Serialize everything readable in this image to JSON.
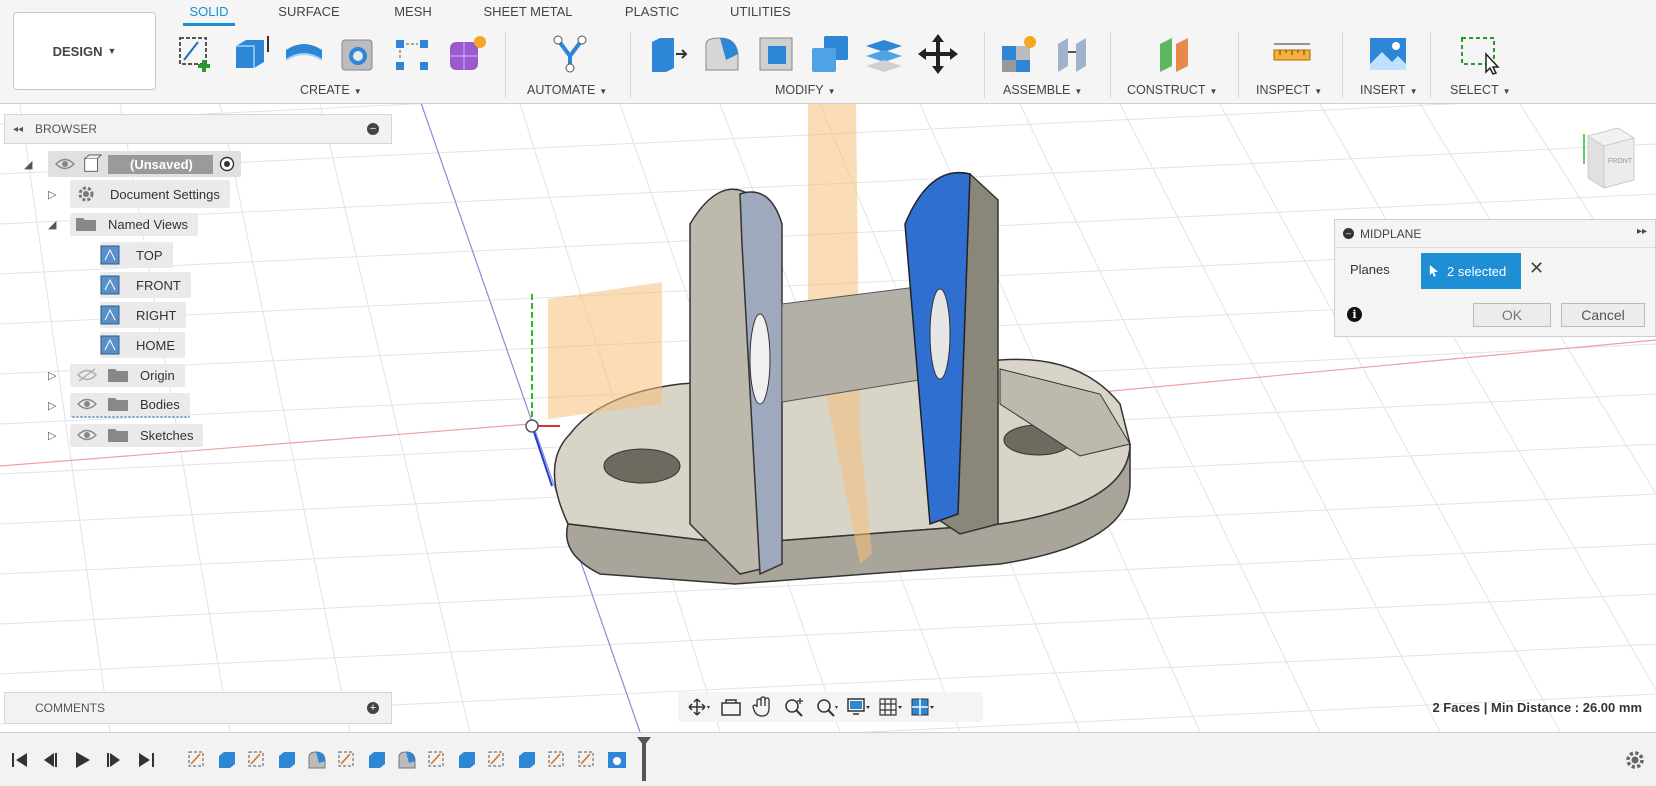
{
  "design_menu": {
    "label": "DESIGN"
  },
  "tabs": [
    {
      "label": "SOLID",
      "active": true
    },
    {
      "label": "SURFACE"
    },
    {
      "label": "MESH"
    },
    {
      "label": "SHEET METAL"
    },
    {
      "label": "PLASTIC"
    },
    {
      "label": "UTILITIES"
    }
  ],
  "toolbar_groups": {
    "create": "CREATE",
    "automate": "AUTOMATE",
    "modify": "MODIFY",
    "assemble": "ASSEMBLE",
    "construct": "CONSTRUCT",
    "inspect": "INSPECT",
    "insert": "INSERT",
    "select": "SELECT"
  },
  "browser": {
    "title": "BROWSER",
    "root": "(Unsaved)",
    "items": {
      "document_settings": "Document Settings",
      "named_views": "Named Views",
      "top": "TOP",
      "front": "FRONT",
      "right": "RIGHT",
      "home": "HOME",
      "origin": "Origin",
      "bodies": "Bodies",
      "sketches": "Sketches"
    }
  },
  "midplane": {
    "title": "MIDPLANE",
    "planes_label": "Planes",
    "selection": "2 selected",
    "ok": "OK",
    "cancel": "Cancel"
  },
  "viewcube": {
    "face": "FRONT"
  },
  "comments": {
    "title": "COMMENTS"
  },
  "status": {
    "text": "2 Faces | Min Distance : 26.00 mm"
  },
  "colors": {
    "accent": "#1a8fd8",
    "selected_face": "#2f6fd0",
    "plane": "#f5c07a",
    "body": "#c9c5b8"
  }
}
